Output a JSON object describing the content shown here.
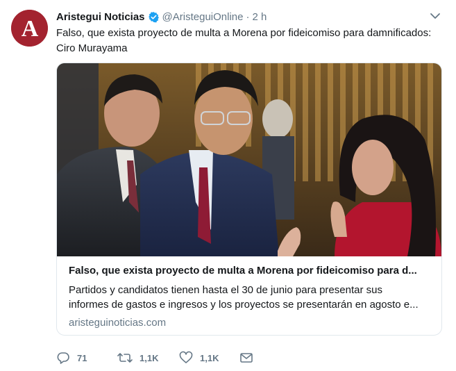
{
  "tweet": {
    "author_name": "Aristegui Noticias",
    "handle": "@AristeguiOnline",
    "separator": "·",
    "time": "2 h",
    "avatar_letter": "A",
    "text": "Falso, que exista proyecto de multa a Morena por fideicomiso para damnificados: Ciro Murayama",
    "card": {
      "title": "Falso, que exista proyecto de multa a Morena por fideicomiso para d...",
      "description_line1": "Partidos y candidatos tienen hasta el 30 de junio para presentar sus",
      "description_line2": "informes de gastos e ingresos y los proyectos se presentarán en agosto e...",
      "domain": "aristeguinoticias.com"
    },
    "actions": {
      "reply_count": "71",
      "retweet_count": "1,1K",
      "like_count": "1,1K"
    }
  },
  "colors": {
    "brand_red": "#a3232f",
    "verified_blue": "#1da1f2",
    "secondary_text": "#657786"
  },
  "icons": [
    "avatar-logo",
    "verified-icon",
    "chevron-down-icon",
    "reply-icon",
    "retweet-icon",
    "like-icon",
    "message-icon"
  ]
}
